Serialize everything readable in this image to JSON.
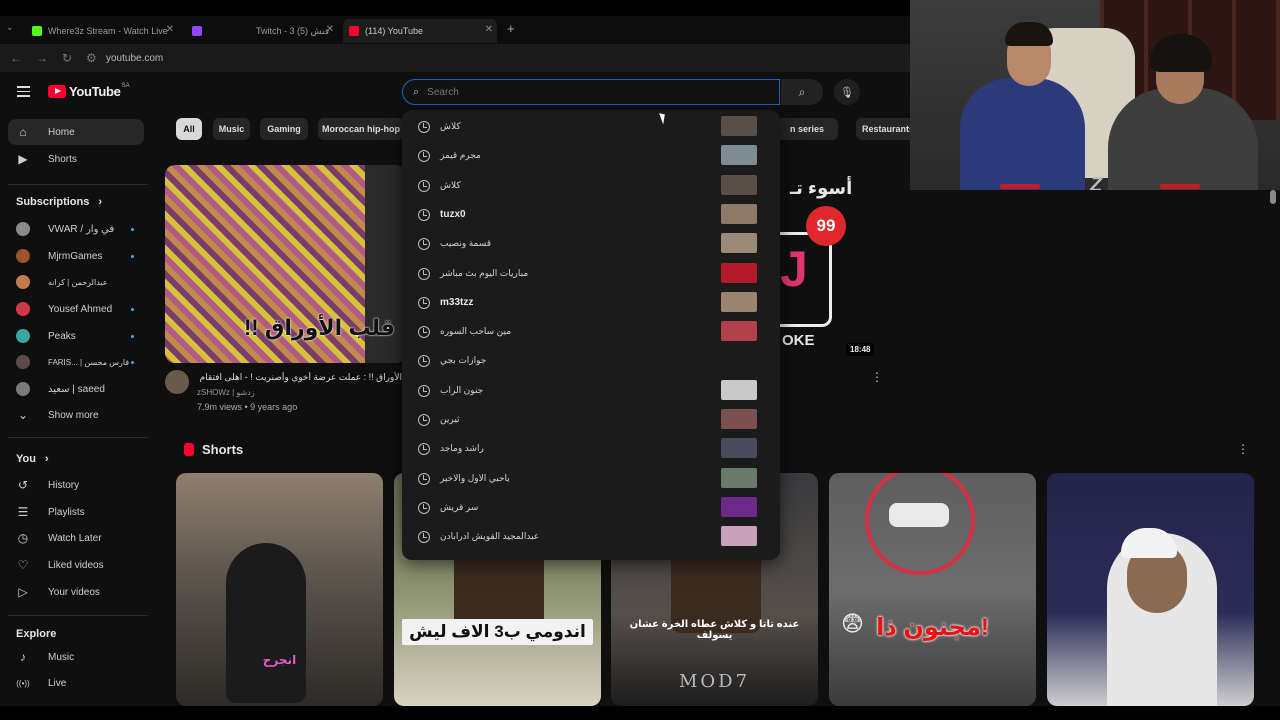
{
  "browser": {
    "tabs": [
      {
        "label": "Where3z Stream - Watch Live ",
        "favicon_color": "#53fc18"
      },
      {
        "label": "Twitch - 3 فنش (5)",
        "favicon_color": "#9146ff"
      },
      {
        "label": "(114) YouTube",
        "favicon_color": "#ff0033"
      }
    ],
    "new_tab": "+",
    "url": "youtube.com"
  },
  "youtube": {
    "logo_text": "YouTube",
    "logo_region": "SA",
    "search": {
      "placeholder": "Search",
      "value": ""
    },
    "chips": [
      "All",
      "Music",
      "Gaming",
      "Moroccan hip-hop",
      "n series",
      "Restaurants"
    ],
    "sidebar": {
      "top": [
        {
          "label": "Home",
          "icon": "home-icon",
          "glyph": "⌂"
        },
        {
          "label": "Shorts",
          "icon": "shorts-icon",
          "glyph": "▶"
        }
      ],
      "subscriptions_header": "Subscriptions",
      "subscriptions": [
        {
          "label": "VWAR / في وار",
          "color": "#8a8a8a",
          "dot": true
        },
        {
          "label": "MjrmGames",
          "color": "#a0522d",
          "dot": true
        },
        {
          "label": "عبدالرحمن | كرانه",
          "color": "#c27a4a",
          "dot": false
        },
        {
          "label": "Yousef Ahmed",
          "color": "#d0384a",
          "dot": true
        },
        {
          "label": "Peaks",
          "color": "#3aa7a0",
          "dot": true
        },
        {
          "label": "FARIS... | فارس محسن",
          "color": "#5a4a4a",
          "dot": true
        },
        {
          "label": "سعيد | saeed",
          "color": "#7a7a7a",
          "dot": false
        }
      ],
      "show_more": "Show more",
      "you_header": "You",
      "you_items": [
        {
          "label": "History",
          "icon": "history-icon",
          "glyph": "↺"
        },
        {
          "label": "Playlists",
          "icon": "playlists-icon",
          "glyph": "☰"
        },
        {
          "label": "Watch Later",
          "icon": "clock-icon",
          "glyph": "◷"
        },
        {
          "label": "Liked videos",
          "icon": "like-icon",
          "glyph": "👍"
        },
        {
          "label": "Your videos",
          "icon": "your-videos-icon",
          "glyph": "▶"
        }
      ],
      "explore_header": "Explore",
      "explore_items": [
        {
          "label": "Music",
          "icon": "music-icon",
          "glyph": "♪"
        },
        {
          "label": "Live",
          "icon": "live-icon",
          "glyph": "((•))"
        }
      ]
    },
    "featured": {
      "thumb_caption": "قلب الأوراق !!",
      "title": "الأوراق !! : عملت عرضة أخوي وأصنريت ! - اهلى افتقام (=",
      "channel": "zSHOWz | زدشو",
      "meta": "7.9m views • 9 years ago"
    },
    "second": {
      "thumb_title": "أسوء تـ",
      "badge": "99",
      "letter": "J",
      "thumb_text": "OKE",
      "duration": "18:48"
    },
    "shorts_header": "Shorts",
    "shorts": [
      {
        "caption": "انجرح"
      },
      {
        "caption": "اندومي ب3 الاف ليش"
      },
      {
        "caption": "عنده تاتا و كلاش عطاه الخرة عشان يسولف",
        "watermark": "MOD7"
      },
      {
        "caption": "مجنون ذا!",
        "emoji": "😨"
      },
      {
        "caption": ""
      }
    ],
    "suggestions": [
      {
        "text": "كلاش",
        "bold": false,
        "thumb": "#5a4e48"
      },
      {
        "text": "مجرم قيمز",
        "bold": false,
        "thumb": "#7f8b93"
      },
      {
        "text": "كلاش",
        "bold": false,
        "thumb": "#5a4e48"
      },
      {
        "text": "tuzx0",
        "bold": true,
        "thumb": "#8f7a6a"
      },
      {
        "text": "قسمة ونصيب",
        "bold": false,
        "thumb": "#9b8a78"
      },
      {
        "text": "مباريات اليوم بث مباشر",
        "bold": false,
        "thumb": "#b21a2a"
      },
      {
        "text": "m33tzz",
        "bold": true,
        "thumb": "#9a8470"
      },
      {
        "text": "مين ساحب السوره",
        "bold": false,
        "thumb": "#b0404a"
      },
      {
        "text": "جوازات بجي",
        "bold": false,
        "thumb": ""
      },
      {
        "text": "جنون الراب",
        "bold": false,
        "thumb": "#c9c9c9"
      },
      {
        "text": "ثيرين",
        "bold": false,
        "thumb": "#7a5050"
      },
      {
        "text": "راشد وماجد",
        "bold": false,
        "thumb": "#4a4a5a"
      },
      {
        "text": "ياحبي الاول والاخير",
        "bold": false,
        "thumb": "#6a7a6a"
      },
      {
        "text": "سر قريش",
        "bold": false,
        "thumb": "#6a2a8a"
      },
      {
        "text": "عبدالمجيد القويش ادرابادن",
        "bold": false,
        "thumb": "#c8a0b8"
      }
    ]
  }
}
